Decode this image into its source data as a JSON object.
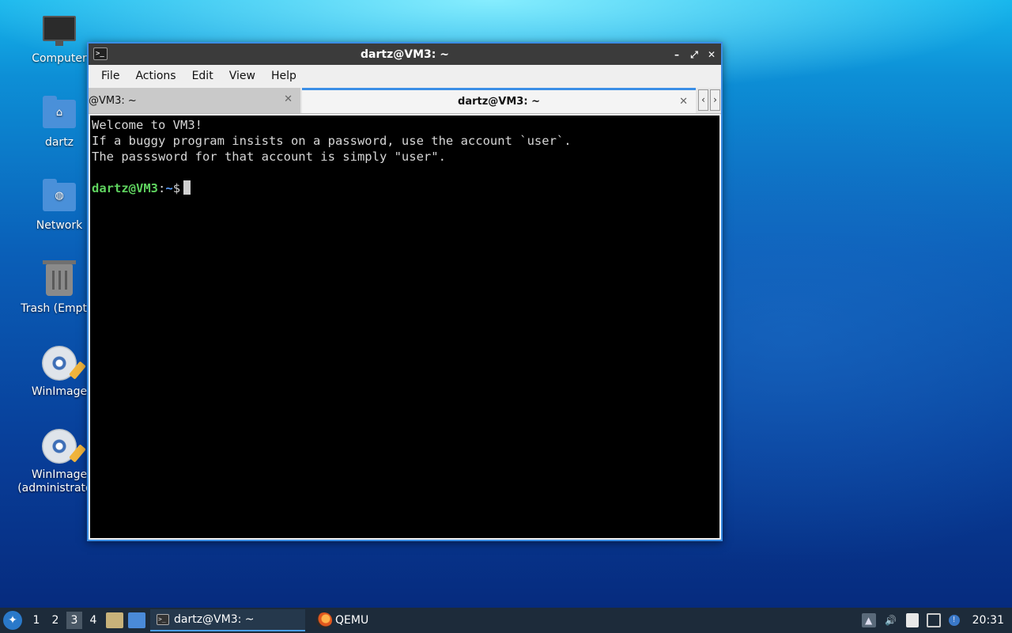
{
  "desktop": {
    "icons": [
      {
        "label": "Computer",
        "icon": "computer-icon"
      },
      {
        "label": "dartz",
        "icon": "home-folder-icon"
      },
      {
        "label": "Network",
        "icon": "network-folder-icon"
      },
      {
        "label": "Trash (Empty)",
        "icon": "trash-icon"
      },
      {
        "label": "WinImage",
        "icon": "winimage-icon"
      },
      {
        "label": "WinImage (administrator)",
        "icon": "winimage-admin-icon"
      }
    ]
  },
  "window": {
    "title": "dartz@VM3: ~",
    "controls": {
      "minimize": "–",
      "maximize": "⤢",
      "close": "✕"
    },
    "menu": [
      "File",
      "Actions",
      "Edit",
      "View",
      "Help"
    ],
    "tabs": [
      {
        "label": "@VM3: ~",
        "active": false,
        "close": "✕"
      },
      {
        "label": "dartz@VM3: ~",
        "active": true,
        "close": "✕"
      }
    ],
    "tab_scroll": {
      "left": "‹",
      "right": "›"
    }
  },
  "terminal": {
    "lines": [
      "Welcome to VM3!",
      "If a buggy program insists on a password, use the account `user`.",
      "The passsword for that account is simply \"user\"."
    ],
    "prompt": {
      "user_host": "dartz@VM3",
      "sep": ":",
      "path": "~",
      "symbol": "$"
    }
  },
  "taskbar": {
    "start_icon": "lxqt-start-icon",
    "workspaces": [
      "1",
      "2",
      "3",
      "4"
    ],
    "current_workspace": "3",
    "tasks": [
      {
        "label": "dartz@VM3: ~",
        "icon": "terminal-icon",
        "active": true
      },
      {
        "label": "QEMU",
        "icon": "qemu-icon",
        "active": false
      }
    ],
    "clock": "20:31"
  },
  "colors": {
    "window_border": "#3a8ee6",
    "prompt_user": "#5fd35f",
    "prompt_path": "#5aa0ff",
    "taskbar_bg": "#1d2b3a"
  }
}
